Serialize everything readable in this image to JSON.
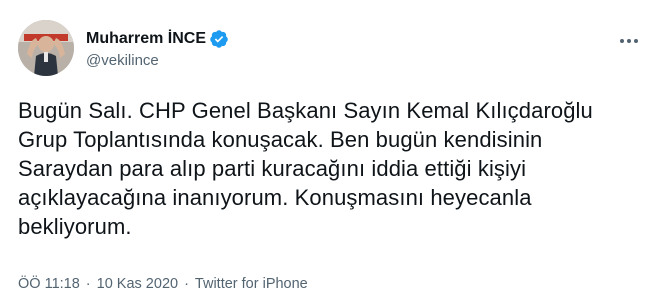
{
  "author": {
    "display_name": "Muharrem İNCE",
    "handle": "@vekilince",
    "verified": true
  },
  "tweet": {
    "text": "Bugün Salı. CHP Genel Başkanı Sayın Kemal Kılıçdaroğlu\nGrup Toplantısında konuşacak. Ben bugün kendisinin\nSaraydan para alıp parti kuracağını iddia ettiği kişiyi\naçıklayacağına inanıyorum. Konuşmasını heyecanla\nbekliyorum.",
    "time": "ÖÖ 11:18",
    "date": "10 Kas 2020",
    "source": "Twitter for iPhone",
    "separator": "·"
  },
  "colors": {
    "verified_badge": "#1d9bf0",
    "secondary_text": "#536471",
    "primary_text": "#0f1419"
  },
  "icons": {
    "verified": "verified-badge-icon",
    "more": "more-options-icon"
  }
}
